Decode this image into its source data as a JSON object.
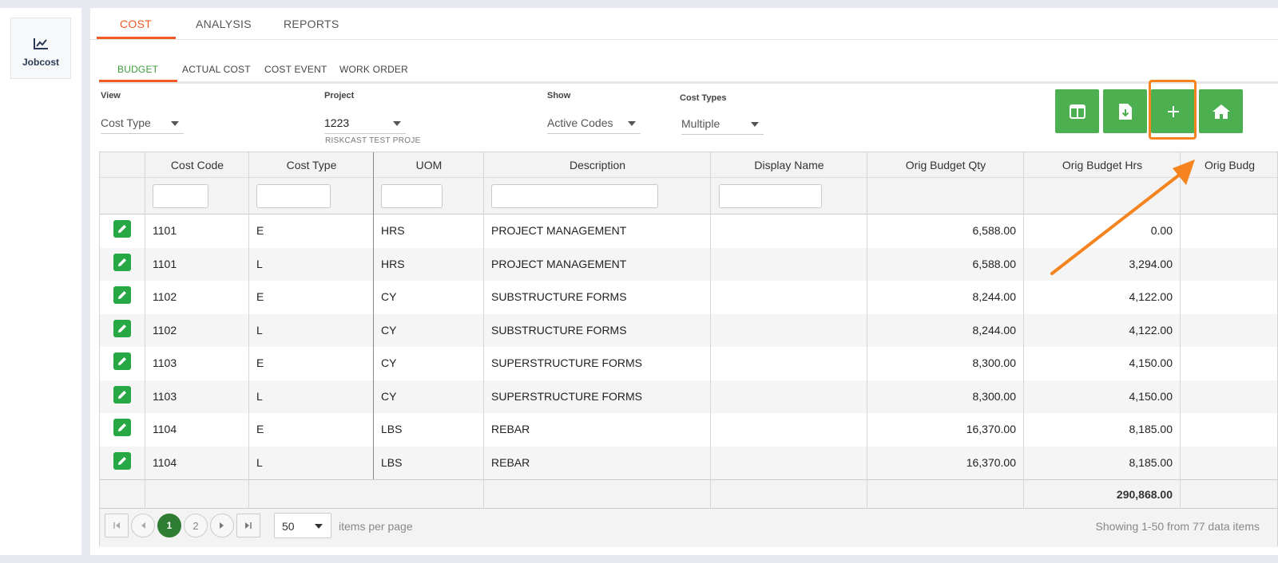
{
  "sidebar": {
    "items": [
      {
        "label": "Jobcost",
        "icon": "trending-chart-icon"
      }
    ]
  },
  "tabs": [
    {
      "label": "COST",
      "active": true
    },
    {
      "label": "ANALYSIS"
    },
    {
      "label": "REPORTS"
    }
  ],
  "subtabs": [
    {
      "label": "BUDGET",
      "active": true
    },
    {
      "label": "ACTUAL COST"
    },
    {
      "label": "COST EVENT"
    },
    {
      "label": "WORK ORDER"
    }
  ],
  "filters": {
    "view": {
      "label": "View",
      "value": "Cost Type"
    },
    "project": {
      "label": "Project",
      "value": "1223",
      "subtitle": "RISKCAST TEST PROJE"
    },
    "show": {
      "label": "Show",
      "value": "Active Codes"
    },
    "cost_types": {
      "label": "Cost Types",
      "value": "Multiple"
    }
  },
  "actions": [
    {
      "icon": "columns-icon"
    },
    {
      "icon": "file-download-icon"
    },
    {
      "icon": "plus-icon"
    },
    {
      "icon": "home-icon"
    }
  ],
  "colors": {
    "accent": "#f15a24",
    "green": "#4caf50",
    "edit_green": "#27a844",
    "highlight": "#f5841f",
    "pager_current": "#2e7d32"
  },
  "grid": {
    "columns": [
      "Cost Code",
      "Cost Type",
      "UOM",
      "Description",
      "Display Name",
      "Orig Budget Qty",
      "Orig Budget Hrs",
      "Orig Budg"
    ],
    "rows": [
      {
        "code": "1101",
        "type": "E",
        "uom": "HRS",
        "desc": "PROJECT MANAGEMENT",
        "display": "",
        "qty": "6,588.00",
        "hrs": "0.00"
      },
      {
        "code": "1101",
        "type": "L",
        "uom": "HRS",
        "desc": "PROJECT MANAGEMENT",
        "display": "",
        "qty": "6,588.00",
        "hrs": "3,294.00"
      },
      {
        "code": "1102",
        "type": "E",
        "uom": "CY",
        "desc": "SUBSTRUCTURE FORMS",
        "display": "",
        "qty": "8,244.00",
        "hrs": "4,122.00"
      },
      {
        "code": "1102",
        "type": "L",
        "uom": "CY",
        "desc": "SUBSTRUCTURE FORMS",
        "display": "",
        "qty": "8,244.00",
        "hrs": "4,122.00"
      },
      {
        "code": "1103",
        "type": "E",
        "uom": "CY",
        "desc": "SUPERSTRUCTURE FORMS",
        "display": "",
        "qty": "8,300.00",
        "hrs": "4,150.00"
      },
      {
        "code": "1103",
        "type": "L",
        "uom": "CY",
        "desc": "SUPERSTRUCTURE FORMS",
        "display": "",
        "qty": "8,300.00",
        "hrs": "4,150.00"
      },
      {
        "code": "1104",
        "type": "E",
        "uom": "LBS",
        "desc": "REBAR",
        "display": "",
        "qty": "16,370.00",
        "hrs": "8,185.00"
      },
      {
        "code": "1104",
        "type": "L",
        "uom": "LBS",
        "desc": "REBAR",
        "display": "",
        "qty": "16,370.00",
        "hrs": "8,185.00"
      }
    ],
    "total_hrs": "290,868.00"
  },
  "pager": {
    "pages": [
      "1",
      "2"
    ],
    "current": "1",
    "page_size": "50",
    "page_size_label": "items per page",
    "info": "Showing 1-50 from 77 data items"
  }
}
